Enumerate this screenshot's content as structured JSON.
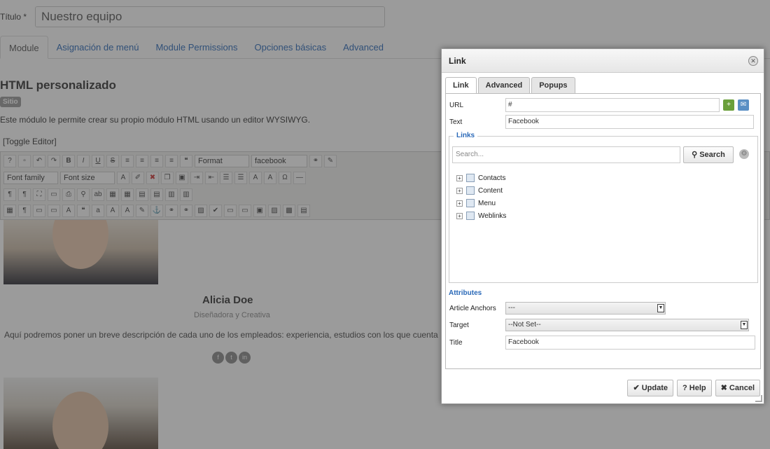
{
  "page": {
    "title_label": "Título *",
    "title_value": "Nuestro equipo",
    "tabs": [
      {
        "label": "Module"
      },
      {
        "label": "Asignación de menú"
      },
      {
        "label": "Module Permissions"
      },
      {
        "label": "Opciones básicas"
      },
      {
        "label": "Advanced"
      }
    ],
    "module_title": "HTML personalizado",
    "site_badge": "Sitio",
    "module_description": "Este módulo le permite crear su propio módulo HTML usando un editor WYSIWYG.",
    "toggle_editor": "[Toggle Editor]"
  },
  "editor": {
    "format_select": "Format",
    "style_select": "facebook",
    "font_family_select": "Font family",
    "font_size_select": "Font size",
    "person_name": "Alicia Doe",
    "person_role": "Diseñadora y Creativa",
    "person_description": "Aquí podremos poner un breve descripción de cada uno de los empleados: experiencia, estudios con los que cuenta"
  },
  "dialog": {
    "title": "Link",
    "tabs": [
      {
        "label": "Link"
      },
      {
        "label": "Advanced"
      },
      {
        "label": "Popups"
      }
    ],
    "url_label": "URL",
    "url_value": "#",
    "text_label": "Text",
    "text_value": "Facebook",
    "links_legend": "Links",
    "search_placeholder": "Search...",
    "search_button": "Search",
    "tree": [
      {
        "label": "Contacts"
      },
      {
        "label": "Content"
      },
      {
        "label": "Menu"
      },
      {
        "label": "Weblinks"
      }
    ],
    "attributes_title": "Attributes",
    "article_anchors_label": "Article Anchors",
    "article_anchors_value": "---",
    "target_label": "Target",
    "target_value": "--Not Set--",
    "title_label": "Title",
    "title_value": "Facebook",
    "update_button": "Update",
    "help_button": "Help",
    "cancel_button": "Cancel"
  },
  "colors": {
    "link_blue": "#2a69b8",
    "overlay": "rgba(55,55,55,0.5)"
  }
}
